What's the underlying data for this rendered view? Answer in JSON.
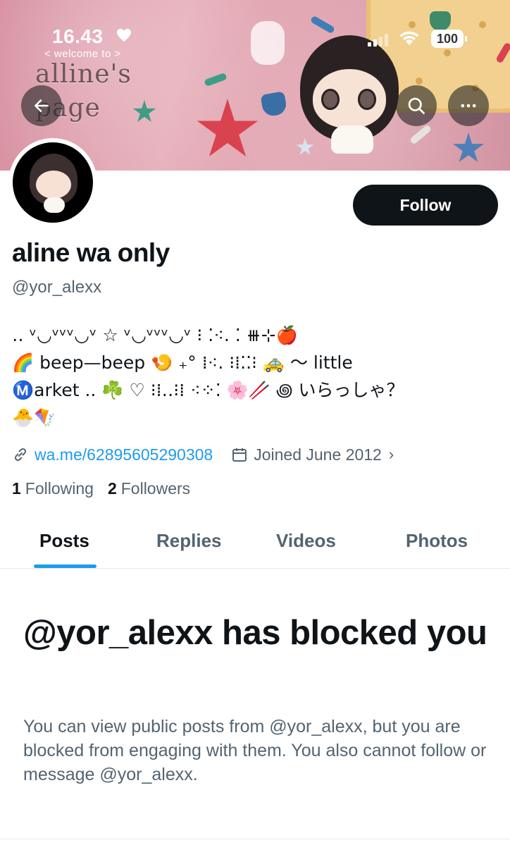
{
  "status_bar": {
    "time": "16.43",
    "battery": "100"
  },
  "banner": {
    "welcome": "< welcome to >",
    "title": "alline's page"
  },
  "profile": {
    "display_name": "aline wa only",
    "handle": "@yor_alexx",
    "follow_label": "Follow",
    "bio": [
      "‥   ᵛ◡ᵛᵛᵛ◡ᵛ ☆ ᵛ◡ᵛᵛᵛ◡ᵛ  ⁝ ⁚⁖. ⁚ ⧻⊹🍎",
      "🌈 beep—beep 🍤 ₊° ⁞⁖. ⁝⁞⁚⁚⁝ 🚕 〜 little",
      "Ⓜ️arket .. ☘️ ♡ ⁝⁞‥⁝⁞ ⁖⁘⁚ 🌸🥢 ꩜ いらっしゃ？",
      "🐣🪁"
    ],
    "link": "wa.me/62895605290308",
    "joined": "Joined June 2012",
    "following_count": "1",
    "following_label": "Following",
    "followers_count": "2",
    "followers_label": "Followers"
  },
  "tabs": [
    {
      "label": "Posts",
      "active": true
    },
    {
      "label": "Replies",
      "active": false
    },
    {
      "label": "Videos",
      "active": false
    },
    {
      "label": "Photos",
      "active": false
    }
  ],
  "blocked": {
    "title": "@yor_alexx has blocked you",
    "body": "You can view public posts from @yor_alexx, but you are blocked from engaging with them. You also cannot follow or message @yor_alexx."
  },
  "icons": {
    "back": "back-arrow-icon",
    "search": "search-icon",
    "more": "more-icon",
    "link": "link-icon",
    "calendar": "calendar-icon"
  },
  "colors": {
    "accent": "#1d9bf0",
    "text": "#0f1419",
    "muted": "#536471"
  }
}
